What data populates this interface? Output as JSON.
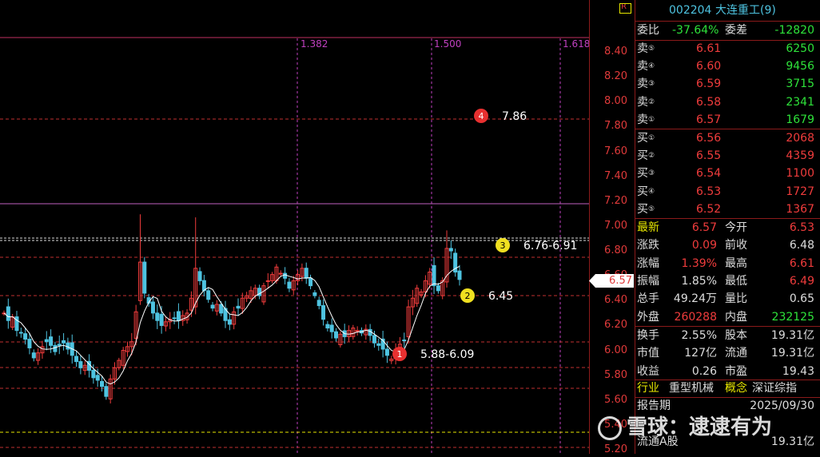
{
  "chart": {
    "fib_labels": [
      "1.382",
      "1.500",
      "1.618"
    ],
    "price_ticks": [
      "8.40",
      "8.20",
      "8.00",
      "7.80",
      "7.60",
      "7.40",
      "7.20",
      "7.00",
      "6.80",
      "6.60",
      "6.40",
      "6.20",
      "6.00",
      "5.80",
      "5.60",
      "5.40",
      "5.20"
    ],
    "current_price_tag": "6.57",
    "annotations": [
      {
        "num": "4",
        "text": "7.86",
        "color": "#e83030"
      },
      {
        "num": "3",
        "text": "6.76-6.91",
        "color": "#f0e020"
      },
      {
        "num": "2",
        "text": "6.45",
        "color": "#f0e020"
      },
      {
        "num": "1",
        "text": "5.88-6.09",
        "color": "#e83030"
      }
    ],
    "colors": {
      "up": "#f03c3c",
      "down": "#4ec3e0",
      "ma": "#ffffff",
      "fib": "#c040c0",
      "level": "#c03030"
    }
  },
  "quote": {
    "flag": "R",
    "code": "002204",
    "name": "大连重工(9)",
    "wb_label": "委比",
    "wb_value": "-37.64%",
    "wc_label": "委差",
    "wc_value": "-12820",
    "asks": [
      {
        "label": "卖",
        "idx": "⑤",
        "price": "6.61",
        "vol": "6250"
      },
      {
        "label": "卖",
        "idx": "④",
        "price": "6.60",
        "vol": "9456"
      },
      {
        "label": "卖",
        "idx": "③",
        "price": "6.59",
        "vol": "3715"
      },
      {
        "label": "卖",
        "idx": "②",
        "price": "6.58",
        "vol": "2341"
      },
      {
        "label": "卖",
        "idx": "①",
        "price": "6.57",
        "vol": "1679"
      }
    ],
    "bids": [
      {
        "label": "买",
        "idx": "①",
        "price": "6.56",
        "vol": "2068"
      },
      {
        "label": "买",
        "idx": "②",
        "price": "6.55",
        "vol": "4359"
      },
      {
        "label": "买",
        "idx": "③",
        "price": "6.54",
        "vol": "1100"
      },
      {
        "label": "买",
        "idx": "④",
        "price": "6.53",
        "vol": "1727"
      },
      {
        "label": "买",
        "idx": "⑤",
        "price": "6.52",
        "vol": "1367"
      }
    ],
    "stats": [
      {
        "l1": "最新",
        "v1": "6.57",
        "c1": "red",
        "l2": "今开",
        "v2": "6.53",
        "c2": "red"
      },
      {
        "l1": "涨跌",
        "v1": "0.09",
        "c1": "red",
        "l2": "前收",
        "v2": "6.48",
        "c2": "white"
      },
      {
        "l1": "涨幅",
        "v1": "1.39%",
        "c1": "red",
        "l2": "最高",
        "v2": "6.61",
        "c2": "red"
      },
      {
        "l1": "振幅",
        "v1": "1.85%",
        "c1": "white",
        "l2": "最低",
        "v2": "6.49",
        "c2": "red"
      },
      {
        "l1": "总手",
        "v1": "49.24万",
        "c1": "white",
        "l2": "量比",
        "v2": "0.65",
        "c2": "white"
      },
      {
        "l1": "外盘",
        "v1": "260288",
        "c1": "red",
        "l2": "内盘",
        "v2": "232125",
        "c2": "green"
      }
    ],
    "fund": [
      {
        "l1": "换手",
        "v1": "2.55%",
        "l2": "股本",
        "v2": "19.31亿"
      },
      {
        "l1": "市值",
        "v1": "127亿",
        "l2": "流通",
        "v2": "19.31亿"
      },
      {
        "l1": "收益",
        "v1": "0.26",
        "l2": "市盈",
        "v2": "19.43"
      }
    ],
    "industry_label": "行业",
    "industry_value": "重型机械",
    "concept_label": "概念",
    "concept_value": "深证综指",
    "report_label": "报告期",
    "report_value": "2025/09/30",
    "float_a_label": "流通A股",
    "float_a_value": "19.31亿"
  },
  "watermark": "雪球：逮逮有为"
}
